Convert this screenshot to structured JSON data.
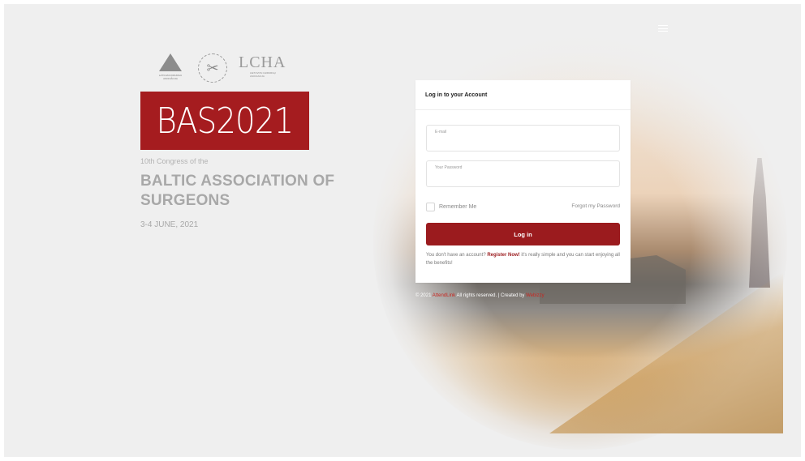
{
  "logos": {
    "las_caption": "LATVIJAS ĶIRURGU ASOCIĀCIJA",
    "lcha_mark": "LCHA",
    "lcha_caption": "LIETUVOS CHIRURGŲ ASOCIACIJA"
  },
  "brand": {
    "title": "BAS2021",
    "subtitle": "10th Congress of the",
    "org_line1": "BALTIC ASSOCIATION OF",
    "org_line2": "SURGEONS",
    "date": "3-4 JUNE, 2021"
  },
  "login": {
    "heading": "Log in to your Account",
    "email_label": "E-mail",
    "email_value": "",
    "password_label": "Your Password",
    "password_value": "",
    "remember_label": "Remember Me",
    "forgot_label": "Forgot my Password",
    "button_label": "Log in",
    "register_prefix": "You don't have an account?",
    "register_link": "Register Now!",
    "register_suffix": "it's really simple and you can start enjoying all the benefits!"
  },
  "footer": {
    "copyright_prefix": "© 2021",
    "brand_link": "AttendLink",
    "rights": "All rights reserved. | Created by",
    "creator_link": "Webizzy"
  },
  "colors": {
    "brand_red": "#a51c1f",
    "button_red": "#9b1b1e",
    "background": "#efefef"
  }
}
